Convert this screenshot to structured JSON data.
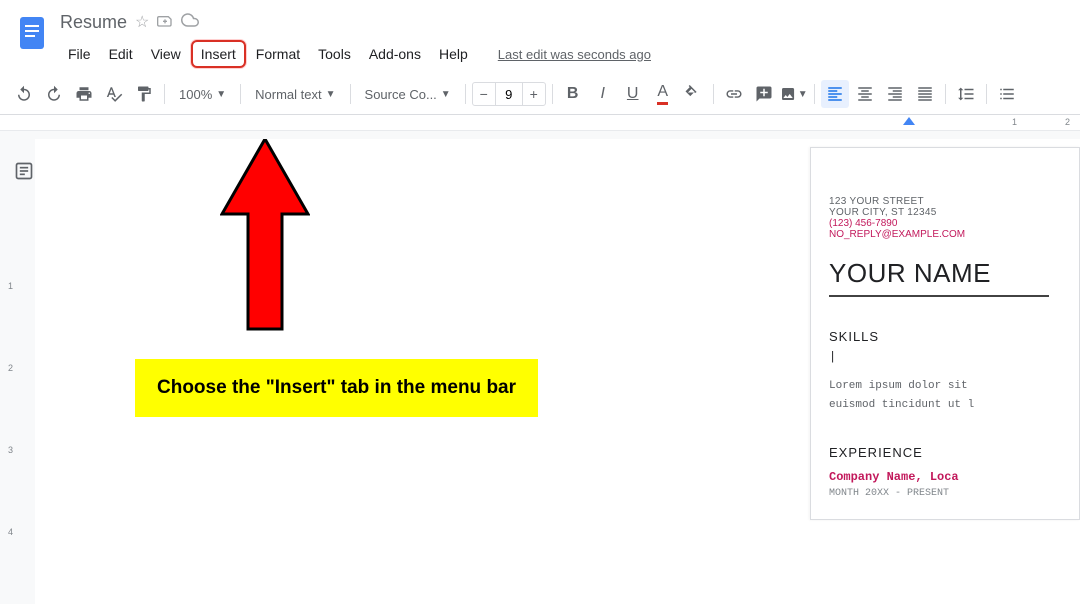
{
  "header": {
    "title": "Resume",
    "menu": [
      "File",
      "Edit",
      "View",
      "Insert",
      "Format",
      "Tools",
      "Add-ons",
      "Help"
    ],
    "highlighted_menu_index": 3,
    "last_edit": "Last edit was seconds ago"
  },
  "toolbar": {
    "zoom": "100%",
    "style": "Normal text",
    "font": "Source Co...",
    "font_size": "9"
  },
  "ruler": {
    "marks": [
      "1",
      "2"
    ]
  },
  "vert_ruler": [
    "1",
    "2",
    "3",
    "4"
  ],
  "annotation": {
    "callout": "Choose the \"Insert\" tab in the menu bar"
  },
  "document": {
    "street": "123 YOUR STREET",
    "city": "YOUR CITY, ST 12345",
    "phone": "(123) 456-7890",
    "email": "NO_REPLY@EXAMPLE.COM",
    "name": "YOUR NAME",
    "skills_head": "SKILLS",
    "cursor": "|",
    "lorem1": "Lorem ipsum dolor sit ",
    "lorem2": "euismod tincidunt ut l",
    "exp_head": "EXPERIENCE",
    "company": "Company Name, Loca",
    "dates": "MONTH 20XX - PRESENT"
  }
}
